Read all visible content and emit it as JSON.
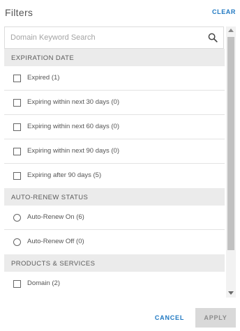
{
  "header": {
    "title": "Filters",
    "clear_label": "CLEAR"
  },
  "search": {
    "placeholder": "Domain Keyword Search",
    "value": "",
    "icon": "search-icon"
  },
  "sections": {
    "expiration": {
      "title": "EXPIRATION DATE",
      "control": "checkbox",
      "items": [
        {
          "label": "Expired (1)",
          "checked": false
        },
        {
          "label": "Expiring within next 30 days (0)",
          "checked": false
        },
        {
          "label": "Expiring within next 60 days (0)",
          "checked": false
        },
        {
          "label": "Expiring within next 90 days (0)",
          "checked": false
        },
        {
          "label": "Expiring after 90 days (5)",
          "checked": false
        }
      ]
    },
    "auto_renew": {
      "title": "AUTO-RENEW STATUS",
      "control": "radio",
      "items": [
        {
          "label": "Auto-Renew On (6)",
          "selected": false
        },
        {
          "label": "Auto-Renew Off (0)",
          "selected": false
        }
      ]
    },
    "products": {
      "title": "PRODUCTS & SERVICES",
      "control": "checkbox",
      "items": [
        {
          "label": "Domain (2)",
          "checked": false
        }
      ]
    }
  },
  "footer": {
    "cancel_label": "CANCEL",
    "apply_label": "APPLY",
    "apply_enabled": false
  },
  "colors": {
    "accent": "#1f78c2",
    "section_bg": "#ebebeb",
    "disabled_button_bg": "#d9d9d9",
    "disabled_button_text": "#8c8c8c",
    "scroll_thumb": "#c1c1c1"
  }
}
